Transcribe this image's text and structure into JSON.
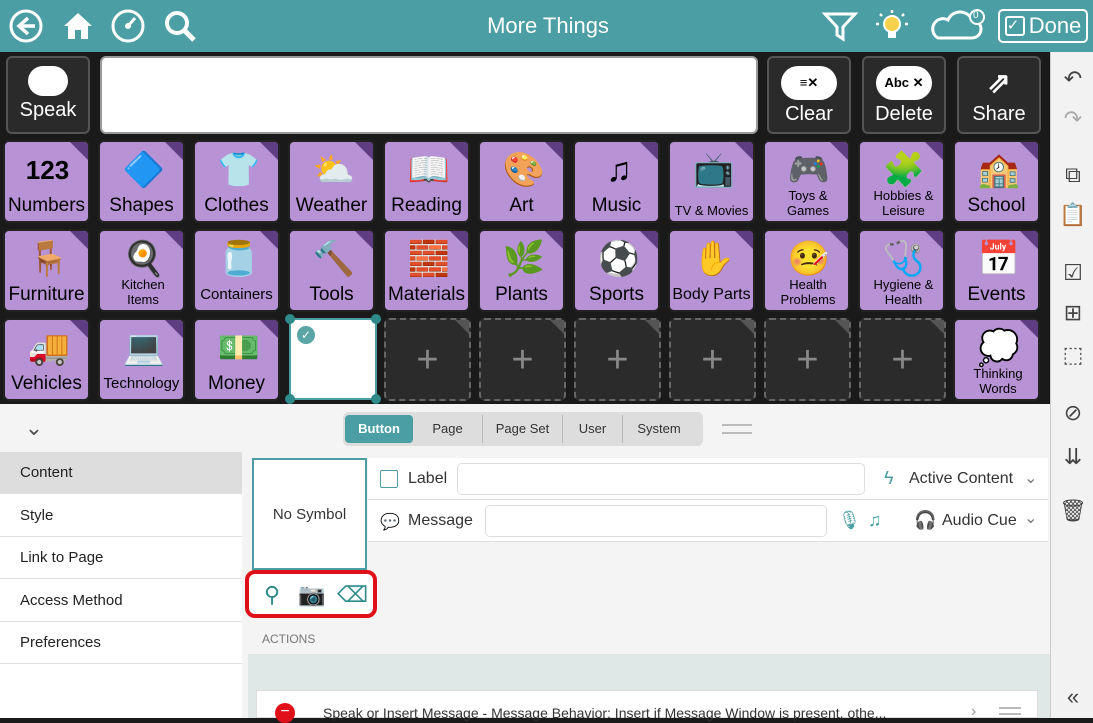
{
  "topbar": {
    "title": "More Things",
    "done_label": "Done",
    "sync_badge": "0",
    "icons": [
      "back-icon",
      "home-icon",
      "dashboard-icon",
      "search-icon",
      "filter-icon",
      "lightbulb-icon",
      "sync-icon"
    ]
  },
  "message_bar": {
    "speak": "Speak",
    "clear": "Clear",
    "delete": "Delete",
    "share": "Share",
    "delete_icon_text": "Abc"
  },
  "grid": {
    "row1": [
      "Numbers",
      "Shapes",
      "Clothes",
      "Weather",
      "Reading",
      "Art",
      "Music",
      "TV & Movies",
      "Toys & Games",
      "Hobbies & Leisure",
      "School"
    ],
    "row2": [
      "Furniture",
      "Kitchen Items",
      "Containers",
      "Tools",
      "Materials",
      "Plants",
      "Sports",
      "Body Parts",
      "Health Problems",
      "Hygiene & Health",
      "Events"
    ],
    "row3": [
      "Vehicles",
      "Technology",
      "Money"
    ],
    "row3_last": "Thinking Words",
    "numbers_pic": "123"
  },
  "segment": {
    "tabs": [
      "Button",
      "Page",
      "Page Set",
      "User",
      "System"
    ],
    "active": "Button"
  },
  "left_nav": [
    "Content",
    "Style",
    "Link to Page",
    "Access Method",
    "Preferences"
  ],
  "symbol": {
    "placeholder": "No Symbol"
  },
  "fields": {
    "label": "Label",
    "message": "Message",
    "active_content": "Active Content",
    "audio_cue": "Audio Cue"
  },
  "actions": {
    "header": "ACTIONS",
    "row": "Speak or Insert Message - Message Behavior: Insert if Message Window is present, othe..."
  }
}
